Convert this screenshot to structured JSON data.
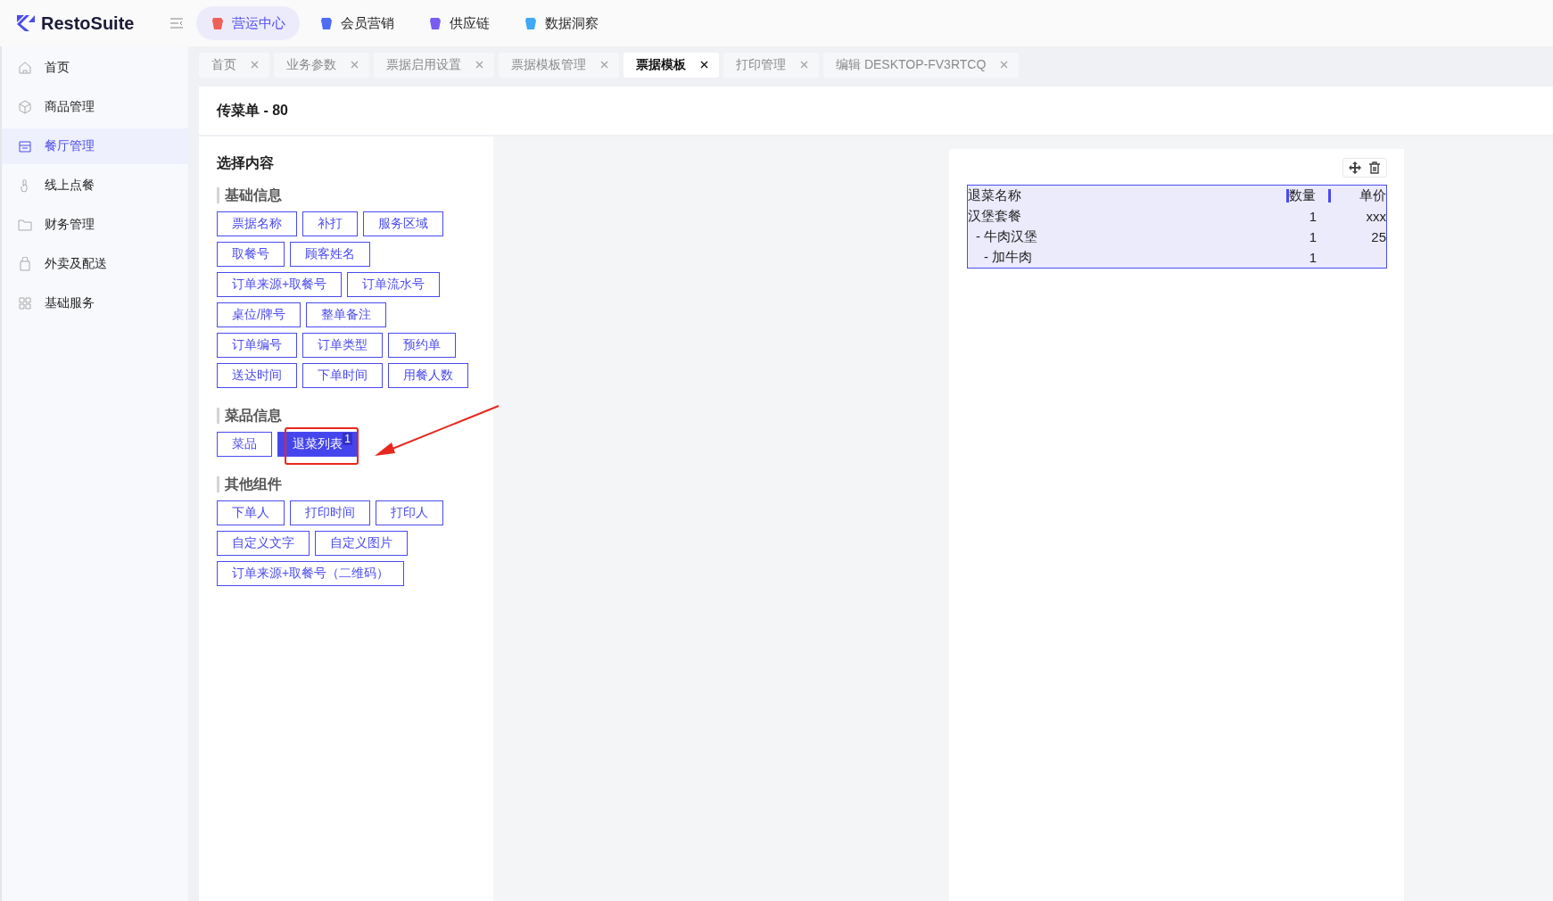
{
  "brand": {
    "name": "RestoSuite"
  },
  "top_nav": [
    {
      "label": "营运中心",
      "selected": true,
      "color": "#f0605a"
    },
    {
      "label": "会员营销",
      "selected": false,
      "color": "#4f6cf5"
    },
    {
      "label": "供应链",
      "selected": false,
      "color": "#7a5cf0"
    },
    {
      "label": "数据洞察",
      "selected": false,
      "color": "#3fa9f5"
    }
  ],
  "sidebar": {
    "items": [
      {
        "label": "首页",
        "selected": false
      },
      {
        "label": "商品管理",
        "selected": false
      },
      {
        "label": "餐厅管理",
        "selected": true
      },
      {
        "label": "线上点餐",
        "selected": false
      },
      {
        "label": "财务管理",
        "selected": false
      },
      {
        "label": "外卖及配送",
        "selected": false
      },
      {
        "label": "基础服务",
        "selected": false
      }
    ]
  },
  "tabs": [
    {
      "label": "首页",
      "selected": false
    },
    {
      "label": "业务参数",
      "selected": false
    },
    {
      "label": "票据启用设置",
      "selected": false
    },
    {
      "label": "票据模板管理",
      "selected": false
    },
    {
      "label": "票据模板",
      "selected": true
    },
    {
      "label": "打印管理",
      "selected": false
    },
    {
      "label": "编辑 DESKTOP-FV3RTCQ",
      "selected": false
    }
  ],
  "page_title": "传菜单 - 80",
  "panel": {
    "title": "选择内容",
    "sections": [
      {
        "title": "基础信息",
        "rows": [
          [
            {
              "label": "票据名称",
              "selected": false
            },
            {
              "label": "补打",
              "selected": false
            },
            {
              "label": "服务区域",
              "selected": false
            }
          ],
          [
            {
              "label": "取餐号",
              "selected": false
            },
            {
              "label": "顾客姓名",
              "selected": false
            }
          ],
          [
            {
              "label": "订单来源+取餐号",
              "selected": false
            },
            {
              "label": "订单流水号",
              "selected": false
            }
          ],
          [
            {
              "label": "桌位/牌号",
              "selected": false
            },
            {
              "label": "整单备注",
              "selected": false
            }
          ],
          [
            {
              "label": "订单编号",
              "selected": false
            },
            {
              "label": "订单类型",
              "selected": false
            },
            {
              "label": "预约单",
              "selected": false
            }
          ],
          [
            {
              "label": "送达时间",
              "selected": false
            },
            {
              "label": "下单时间",
              "selected": false
            },
            {
              "label": "用餐人数",
              "selected": false
            }
          ]
        ]
      },
      {
        "title": "菜品信息",
        "rows": [
          [
            {
              "label": "菜品",
              "selected": false
            },
            {
              "label": "退菜列表",
              "selected": true,
              "badge": "1"
            }
          ]
        ]
      },
      {
        "title": "其他组件",
        "rows": [
          [
            {
              "label": "下单人",
              "selected": false
            },
            {
              "label": "打印时间",
              "selected": false
            },
            {
              "label": "打印人",
              "selected": false
            }
          ],
          [
            {
              "label": "自定义文字",
              "selected": false
            },
            {
              "label": "自定义图片",
              "selected": false
            }
          ],
          [
            {
              "label": "订单来源+取餐号（二维码）",
              "selected": false
            }
          ]
        ]
      }
    ]
  },
  "preview": {
    "columns": [
      "退菜名称",
      "数量",
      "单价"
    ],
    "rows": [
      {
        "name": "汉堡套餐",
        "qty": "1",
        "price": "xxx",
        "children": [
          {
            "name": "- 牛肉汉堡",
            "qty": "1",
            "price": "25",
            "children": [
              {
                "name": "- 加牛肉",
                "qty": "1"
              }
            ]
          }
        ]
      }
    ]
  }
}
